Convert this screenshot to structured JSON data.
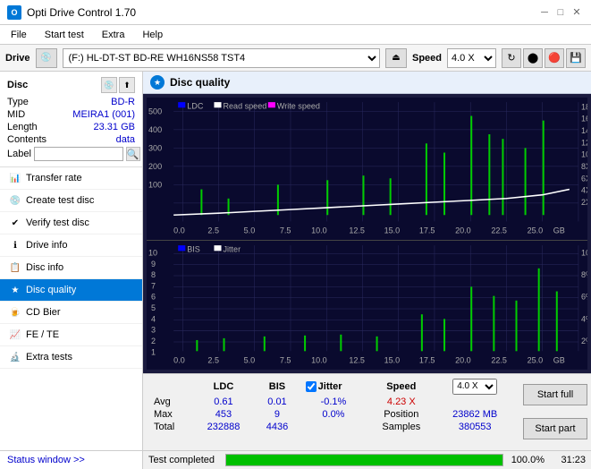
{
  "titleBar": {
    "icon": "O",
    "title": "Opti Drive Control 1.70",
    "minimize": "─",
    "maximize": "□",
    "close": "✕"
  },
  "menu": {
    "items": [
      "File",
      "Start test",
      "Extra",
      "Help"
    ]
  },
  "driveBar": {
    "label": "Drive",
    "driveValue": "(F:)  HL-DT-ST BD-RE  WH16NS58 TST4",
    "speedLabel": "Speed",
    "speedValue": "4.0 X"
  },
  "disc": {
    "title": "Disc",
    "type_label": "Type",
    "type_val": "BD-R",
    "mid_label": "MID",
    "mid_val": "MEIRA1 (001)",
    "length_label": "Length",
    "length_val": "23.31 GB",
    "contents_label": "Contents",
    "contents_val": "data",
    "label_label": "Label",
    "label_val": ""
  },
  "navItems": [
    {
      "id": "transfer-rate",
      "label": "Transfer rate",
      "icon": "📊"
    },
    {
      "id": "create-test-disc",
      "label": "Create test disc",
      "icon": "💿"
    },
    {
      "id": "verify-test-disc",
      "label": "Verify test disc",
      "icon": "✔"
    },
    {
      "id": "drive-info",
      "label": "Drive info",
      "icon": "ℹ"
    },
    {
      "id": "disc-info",
      "label": "Disc info",
      "icon": "📋"
    },
    {
      "id": "disc-quality",
      "label": "Disc quality",
      "icon": "★",
      "active": true
    },
    {
      "id": "cd-bier",
      "label": "CD Bier",
      "icon": "🍺"
    },
    {
      "id": "fe-te",
      "label": "FE / TE",
      "icon": "📈"
    },
    {
      "id": "extra-tests",
      "label": "Extra tests",
      "icon": "🔬"
    }
  ],
  "statusWindowLabel": "Status window >>",
  "contentTitle": "Disc quality",
  "chart1": {
    "legend": [
      "LDC",
      "Read speed",
      "Write speed"
    ],
    "yMax": 500,
    "yMaxRight": 18,
    "xMax": 25,
    "xLabel": "GB"
  },
  "chart2": {
    "legend": [
      "BIS",
      "Jitter"
    ],
    "yMax": 10,
    "yMaxRight": 10,
    "xMax": 25,
    "xLabel": "GB"
  },
  "statsTable": {
    "headers": [
      "",
      "LDC",
      "BIS",
      "",
      "Jitter",
      "Speed",
      ""
    ],
    "rows": [
      {
        "label": "Avg",
        "ldc": "0.61",
        "bis": "0.01",
        "jitter": "-0.1%",
        "speed": "4.23 X",
        "speed2": "4.0 X"
      },
      {
        "label": "Max",
        "ldc": "453",
        "bis": "9",
        "jitter": "0.0%",
        "position_label": "Position",
        "position_val": "23862 MB"
      },
      {
        "label": "Total",
        "ldc": "232888",
        "bis": "4436",
        "jitter": "",
        "samples_label": "Samples",
        "samples_val": "380553"
      }
    ]
  },
  "buttons": {
    "startFull": "Start full",
    "startPart": "Start part"
  },
  "progress": {
    "percent": "100.0%",
    "barWidth": 100,
    "statusText": "Test completed",
    "time": "31:23"
  }
}
